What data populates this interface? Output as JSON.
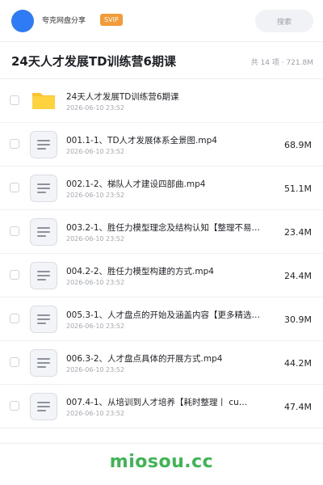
{
  "header": {
    "user_name": "夸克网盘分享",
    "badge": "SVIP",
    "search_placeholder": "搜索",
    "avatar_color": "#2f7bf6"
  },
  "title_bar": {
    "title": "24天人才发展TD训练营6期课",
    "summary": "共 14 项 · 721.8M"
  },
  "files": [
    {
      "type": "folder",
      "icon": "folder-icon",
      "name": "24天人才发展TD训练营6期课",
      "date": "2026-06-10 23:52",
      "size": ""
    },
    {
      "type": "file",
      "icon": "document-icon",
      "name": "001.1-1、TD人才发展体系全景图.mp4",
      "date": "2026-06-10 23:52",
      "size": "68.9M"
    },
    {
      "type": "file",
      "icon": "document-icon",
      "name": "002.1-2、梯队人才建设四部曲.mp4",
      "date": "2026-06-10 23:52",
      "size": "51.1M"
    },
    {
      "type": "file",
      "icon": "document-icon",
      "name": "003.2-1、胜任力模型理念及结构认知【整理不易…",
      "date": "2026-06-10 23:52",
      "size": "23.4M"
    },
    {
      "type": "file",
      "icon": "document-icon",
      "name": "004.2-2、胜任力模型构建的方式.mp4",
      "date": "2026-06-10 23:52",
      "size": "24.4M"
    },
    {
      "type": "file",
      "icon": "document-icon",
      "name": "005.3-1、人才盘点的开始及涵盖内容【更多精选…",
      "date": "2026-06-10 23:52",
      "size": "30.9M"
    },
    {
      "type": "file",
      "icon": "document-icon",
      "name": "006.3-2、人才盘点具体的开展方式.mp4",
      "date": "2026-06-10 23:52",
      "size": "44.2M"
    },
    {
      "type": "file",
      "icon": "document-icon",
      "name": "007.4-1、从培训到人才培养【耗时整理丨 cu…",
      "date": "2026-06-10 23:52",
      "size": "47.4M"
    }
  ],
  "footer": {
    "watermark": "miosou.cc",
    "watermark_color": "#3cb552"
  }
}
